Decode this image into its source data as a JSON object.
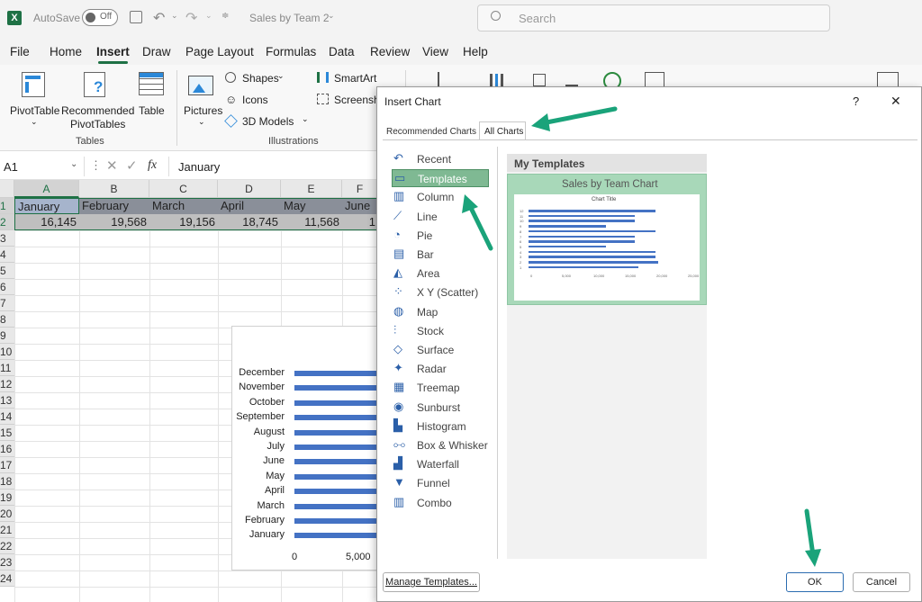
{
  "titlebar": {
    "autosave_label": "AutoSave",
    "autosave_state": "Off",
    "doc_title": "Sales by Team 2",
    "search_placeholder": "Search"
  },
  "menu": [
    "File",
    "Home",
    "Insert",
    "Draw",
    "Page Layout",
    "Formulas",
    "Data",
    "Review",
    "View",
    "Help"
  ],
  "ribbon": {
    "pivottable": "PivotTable",
    "recommended_pivot_line1": "Recommended",
    "recommended_pivot_line2": "PivotTables",
    "table": "Table",
    "tables_group": "Tables",
    "pictures": "Pictures",
    "shapes": "Shapes",
    "icons": "Icons",
    "models3d": "3D Models",
    "smartart": "SmartArt",
    "screenshot": "Screensho",
    "illustrations_group": "Illustrations"
  },
  "formula_bar": {
    "name_box": "A1",
    "fx": "fx",
    "value": "January"
  },
  "sheet": {
    "columns": [
      "A",
      "B",
      "C",
      "D",
      "E",
      "F"
    ],
    "rows": [
      "1",
      "2",
      "3",
      "4",
      "5",
      "6",
      "7",
      "8",
      "9",
      "10",
      "11",
      "12",
      "13",
      "14",
      "15",
      "16",
      "17",
      "18",
      "19",
      "20",
      "21",
      "22",
      "23",
      "24"
    ],
    "row1": [
      "January",
      "February",
      "March",
      "April",
      "May",
      "June"
    ],
    "row2": [
      "16,145",
      "19,568",
      "19,156",
      "18,745",
      "11,568",
      "1"
    ]
  },
  "bg_chart": {
    "categories": [
      "December",
      "November",
      "October",
      "September",
      "August",
      "July",
      "June",
      "May",
      "April",
      "March",
      "February",
      "January"
    ],
    "ticks": [
      "0",
      "5,000"
    ]
  },
  "dialog": {
    "title": "Insert Chart",
    "help": "?",
    "close": "✕",
    "tab_recommended": "Recommended Charts",
    "tab_all": "All Charts",
    "chart_types": [
      "Recent",
      "Templates",
      "Column",
      "Line",
      "Pie",
      "Bar",
      "Area",
      "X Y (Scatter)",
      "Map",
      "Stock",
      "Surface",
      "Radar",
      "Treemap",
      "Sunburst",
      "Histogram",
      "Box & Whisker",
      "Waterfall",
      "Funnel",
      "Combo"
    ],
    "selected_type": "Templates",
    "section_header": "My Templates",
    "template_name": "Sales by Team Chart",
    "thumb_title": "Chart Title",
    "thumb_ticks": [
      "0",
      "5,000",
      "10,000",
      "15,000",
      "20,000",
      "25,000"
    ],
    "manage_button": "Manage Templates...",
    "ok_button": "OK",
    "cancel_button": "Cancel"
  },
  "colors": {
    "excel_green": "#1e7145",
    "arrow_teal": "#1aa37a",
    "bar_blue": "#4472c4",
    "template_green": "#a8d8b9"
  }
}
